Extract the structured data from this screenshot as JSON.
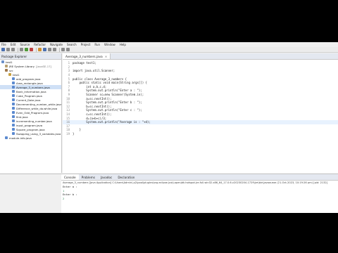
{
  "menu": [
    "File",
    "Edit",
    "Source",
    "Refactor",
    "Navigate",
    "Search",
    "Project",
    "Run",
    "Window",
    "Help"
  ],
  "package_explorer": {
    "title": "Package Explorer",
    "items": [
      {
        "label": "test1",
        "depth": 0,
        "icon": "project-icon"
      },
      {
        "label": "JRE System Library",
        "decor": "[JavaSE-17]",
        "depth": 1,
        "icon": "library-icon"
      },
      {
        "label": "src",
        "depth": 1,
        "icon": "source-folder-icon"
      },
      {
        "label": "test1",
        "depth": 2,
        "icon": "package-icon"
      },
      {
        "label": "add_program.java",
        "depth": 3,
        "icon": "java-file-icon"
      },
      {
        "label": "Area_rectangle.java",
        "depth": 3,
        "icon": "java-file-icon"
      },
      {
        "label": "Average_3_numbers.java",
        "depth": 3,
        "icon": "java-file-icon",
        "selected": true
      },
      {
        "label": "Bank_Information.java",
        "depth": 3,
        "icon": "java-file-icon"
      },
      {
        "label": "Cube_Program.java",
        "depth": 3,
        "icon": "java-file-icon"
      },
      {
        "label": "Current_Date.java",
        "depth": 3,
        "icon": "java-file-icon"
      },
      {
        "label": "Decrementing_number_while.java",
        "depth": 3,
        "icon": "java-file-icon"
      },
      {
        "label": "Difference_while_do.while.java",
        "depth": 3,
        "icon": "java-file-icon"
      },
      {
        "label": "Even_Odd_Program.java",
        "depth": 3,
        "icon": "java-file-icon"
      },
      {
        "label": "first.java",
        "depth": 3,
        "icon": "java-file-icon"
      },
      {
        "label": "incrementing_number.java",
        "depth": 3,
        "icon": "java-file-icon"
      },
      {
        "label": "input_program.java",
        "depth": 3,
        "icon": "java-file-icon"
      },
      {
        "label": "Square_program.java",
        "depth": 3,
        "icon": "java-file-icon"
      },
      {
        "label": "Swapping_using_3_variables.java",
        "depth": 3,
        "icon": "java-file-icon"
      },
      {
        "label": "module-info.java",
        "depth": 1,
        "icon": "java-file-icon"
      }
    ]
  },
  "editor": {
    "tab_label": "Average_3_numbers.java",
    "lines": [
      {
        "n": "1",
        "t": "package test1;"
      },
      {
        "n": "2",
        "t": ""
      },
      {
        "n": "3",
        "t": "import java.util.Scanner;"
      },
      {
        "n": "4",
        "t": ""
      },
      {
        "n": "5",
        "t": "public class Average_3_numbers {"
      },
      {
        "n": "6",
        "t": "    public static void main(String args[]) {"
      },
      {
        "n": "7",
        "t": "        int a,b,c,d;"
      },
      {
        "n": "8",
        "t": "        System.out.println(\"Enter a : \");"
      },
      {
        "n": "9",
        "t": "        Scanner sc=new Scanner(System.in);"
      },
      {
        "n": "10",
        "t": "        a=sc.nextInt();"
      },
      {
        "n": "11",
        "t": "        System.out.println(\"Enter b : \");"
      },
      {
        "n": "12",
        "t": "        b=sc.nextInt();"
      },
      {
        "n": "13",
        "t": "        System.out.println(\"Enter c : \");"
      },
      {
        "n": "14",
        "t": "        c=sc.nextInt();"
      },
      {
        "n": "15",
        "t": "        d=(a+b+c)/3;"
      },
      {
        "n": "16",
        "t": "        System.out.println(\"Average is : \"+d);"
      },
      {
        "n": "17",
        "t": ""
      },
      {
        "n": "18",
        "t": "    }"
      },
      {
        "n": "19",
        "t": "}"
      }
    ]
  },
  "console": {
    "tabs": [
      "Console",
      "Problems",
      "Javadoc",
      "Declaration"
    ],
    "title": "Average_3_numbers [Java Application] C:\\Users\\Admin\\.p2\\pool\\plugins\\org.eclipse.justj.openjdk.hotspot.jre.full.win32.x86_64_17.0.6.v20230204-1729\\jre\\bin\\javaw.exe (21-Oct-2023, 10:19:26 pm) [pid: 2132]",
    "lines": [
      {
        "t": "Enter a : ",
        "input": false
      },
      {
        "t": "1",
        "input": true
      },
      {
        "t": "Enter b : ",
        "input": false
      },
      {
        "t": "2",
        "input": true
      }
    ]
  }
}
